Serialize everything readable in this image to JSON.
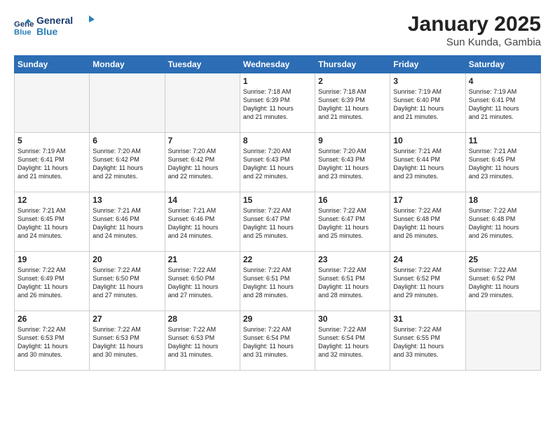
{
  "header": {
    "logo_line1": "General",
    "logo_line2": "Blue",
    "month_year": "January 2025",
    "location": "Sun Kunda, Gambia"
  },
  "weekdays": [
    "Sunday",
    "Monday",
    "Tuesday",
    "Wednesday",
    "Thursday",
    "Friday",
    "Saturday"
  ],
  "weeks": [
    [
      {
        "day": "",
        "info": ""
      },
      {
        "day": "",
        "info": ""
      },
      {
        "day": "",
        "info": ""
      },
      {
        "day": "1",
        "info": "Sunrise: 7:18 AM\nSunset: 6:39 PM\nDaylight: 11 hours\nand 21 minutes."
      },
      {
        "day": "2",
        "info": "Sunrise: 7:18 AM\nSunset: 6:39 PM\nDaylight: 11 hours\nand 21 minutes."
      },
      {
        "day": "3",
        "info": "Sunrise: 7:19 AM\nSunset: 6:40 PM\nDaylight: 11 hours\nand 21 minutes."
      },
      {
        "day": "4",
        "info": "Sunrise: 7:19 AM\nSunset: 6:41 PM\nDaylight: 11 hours\nand 21 minutes."
      }
    ],
    [
      {
        "day": "5",
        "info": "Sunrise: 7:19 AM\nSunset: 6:41 PM\nDaylight: 11 hours\nand 21 minutes."
      },
      {
        "day": "6",
        "info": "Sunrise: 7:20 AM\nSunset: 6:42 PM\nDaylight: 11 hours\nand 22 minutes."
      },
      {
        "day": "7",
        "info": "Sunrise: 7:20 AM\nSunset: 6:42 PM\nDaylight: 11 hours\nand 22 minutes."
      },
      {
        "day": "8",
        "info": "Sunrise: 7:20 AM\nSunset: 6:43 PM\nDaylight: 11 hours\nand 22 minutes."
      },
      {
        "day": "9",
        "info": "Sunrise: 7:20 AM\nSunset: 6:43 PM\nDaylight: 11 hours\nand 23 minutes."
      },
      {
        "day": "10",
        "info": "Sunrise: 7:21 AM\nSunset: 6:44 PM\nDaylight: 11 hours\nand 23 minutes."
      },
      {
        "day": "11",
        "info": "Sunrise: 7:21 AM\nSunset: 6:45 PM\nDaylight: 11 hours\nand 23 minutes."
      }
    ],
    [
      {
        "day": "12",
        "info": "Sunrise: 7:21 AM\nSunset: 6:45 PM\nDaylight: 11 hours\nand 24 minutes."
      },
      {
        "day": "13",
        "info": "Sunrise: 7:21 AM\nSunset: 6:46 PM\nDaylight: 11 hours\nand 24 minutes."
      },
      {
        "day": "14",
        "info": "Sunrise: 7:21 AM\nSunset: 6:46 PM\nDaylight: 11 hours\nand 24 minutes."
      },
      {
        "day": "15",
        "info": "Sunrise: 7:22 AM\nSunset: 6:47 PM\nDaylight: 11 hours\nand 25 minutes."
      },
      {
        "day": "16",
        "info": "Sunrise: 7:22 AM\nSunset: 6:47 PM\nDaylight: 11 hours\nand 25 minutes."
      },
      {
        "day": "17",
        "info": "Sunrise: 7:22 AM\nSunset: 6:48 PM\nDaylight: 11 hours\nand 26 minutes."
      },
      {
        "day": "18",
        "info": "Sunrise: 7:22 AM\nSunset: 6:48 PM\nDaylight: 11 hours\nand 26 minutes."
      }
    ],
    [
      {
        "day": "19",
        "info": "Sunrise: 7:22 AM\nSunset: 6:49 PM\nDaylight: 11 hours\nand 26 minutes."
      },
      {
        "day": "20",
        "info": "Sunrise: 7:22 AM\nSunset: 6:50 PM\nDaylight: 11 hours\nand 27 minutes."
      },
      {
        "day": "21",
        "info": "Sunrise: 7:22 AM\nSunset: 6:50 PM\nDaylight: 11 hours\nand 27 minutes."
      },
      {
        "day": "22",
        "info": "Sunrise: 7:22 AM\nSunset: 6:51 PM\nDaylight: 11 hours\nand 28 minutes."
      },
      {
        "day": "23",
        "info": "Sunrise: 7:22 AM\nSunset: 6:51 PM\nDaylight: 11 hours\nand 28 minutes."
      },
      {
        "day": "24",
        "info": "Sunrise: 7:22 AM\nSunset: 6:52 PM\nDaylight: 11 hours\nand 29 minutes."
      },
      {
        "day": "25",
        "info": "Sunrise: 7:22 AM\nSunset: 6:52 PM\nDaylight: 11 hours\nand 29 minutes."
      }
    ],
    [
      {
        "day": "26",
        "info": "Sunrise: 7:22 AM\nSunset: 6:53 PM\nDaylight: 11 hours\nand 30 minutes."
      },
      {
        "day": "27",
        "info": "Sunrise: 7:22 AM\nSunset: 6:53 PM\nDaylight: 11 hours\nand 30 minutes."
      },
      {
        "day": "28",
        "info": "Sunrise: 7:22 AM\nSunset: 6:53 PM\nDaylight: 11 hours\nand 31 minutes."
      },
      {
        "day": "29",
        "info": "Sunrise: 7:22 AM\nSunset: 6:54 PM\nDaylight: 11 hours\nand 31 minutes."
      },
      {
        "day": "30",
        "info": "Sunrise: 7:22 AM\nSunset: 6:54 PM\nDaylight: 11 hours\nand 32 minutes."
      },
      {
        "day": "31",
        "info": "Sunrise: 7:22 AM\nSunset: 6:55 PM\nDaylight: 11 hours\nand 33 minutes."
      },
      {
        "day": "",
        "info": ""
      }
    ]
  ]
}
